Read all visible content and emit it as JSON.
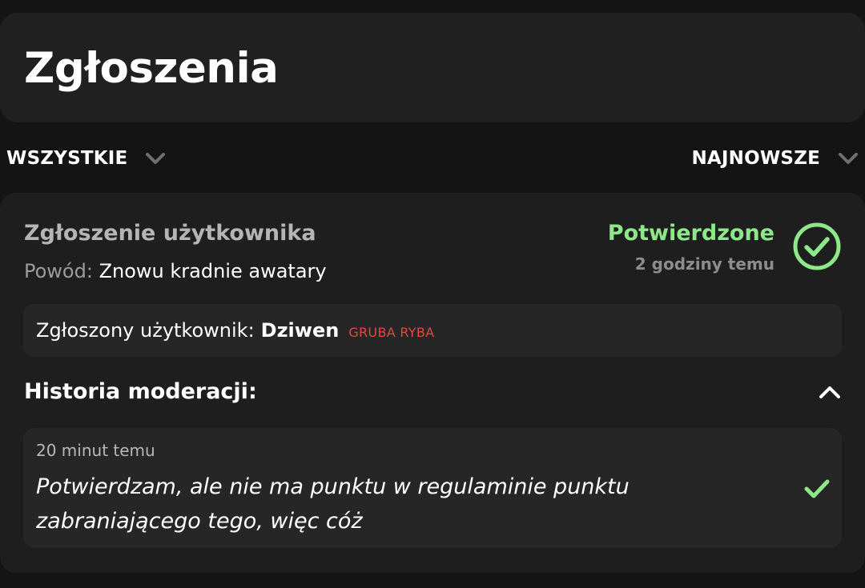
{
  "header": {
    "title": "Zgłoszenia"
  },
  "filters": {
    "category": {
      "label": "WSZYSTKIE",
      "icon": "chevron-down-icon"
    },
    "sort": {
      "label": "NAJNOWSZE",
      "icon": "chevron-down-icon"
    }
  },
  "report": {
    "title": "Zgłoszenie użytkownika",
    "reason_label": "Powód:",
    "reason": "Znowu kradnie awatary",
    "status": "Potwierdzone",
    "status_time": "2 godziny temu",
    "status_icon": "check-circle-icon",
    "reported_user": {
      "label": "Zgłoszony użytkownik:",
      "name": "Dziwen",
      "rank": "GRUBA RYBA"
    },
    "history": {
      "title": "Historia moderacji:",
      "toggle_icon": "chevron-up-icon",
      "entries": [
        {
          "time": "20 minut temu",
          "text": "Potwierdzam, ale nie ma punktu w regulaminie punktu zabraniającego tego, więc cóż",
          "icon": "check-icon"
        }
      ]
    }
  },
  "colors": {
    "background": "#141414",
    "card": "#1e1e1e",
    "inner_box": "#262626",
    "confirmed_green": "#8ee88a",
    "rank_red": "#e24a3d"
  }
}
